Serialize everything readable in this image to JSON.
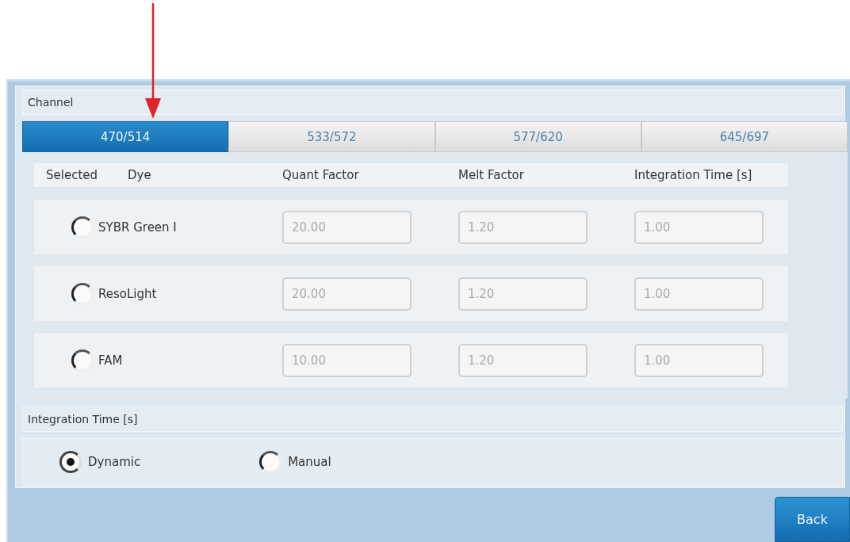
{
  "channel": {
    "title": "Channel",
    "tabs": [
      {
        "label": "470/514",
        "selected": true
      },
      {
        "label": "533/572",
        "selected": false
      },
      {
        "label": "577/620",
        "selected": false
      },
      {
        "label": "645/697",
        "selected": false
      }
    ]
  },
  "dyes": {
    "columns": [
      "Selected",
      "Dye",
      "Quant Factor",
      "Melt Factor",
      "Integration Time [s]"
    ],
    "rows": [
      {
        "name": "SYBR Green I",
        "selected": false,
        "quant_factor": "20.00",
        "melt_factor": "1.20",
        "integration_time": "1.00"
      },
      {
        "name": "ResoLight",
        "selected": false,
        "quant_factor": "20.00",
        "melt_factor": "1.20",
        "integration_time": "1.00"
      },
      {
        "name": "FAM",
        "selected": false,
        "quant_factor": "10.00",
        "melt_factor": "1.20",
        "integration_time": "1.00"
      }
    ]
  },
  "integration_time": {
    "title": "Integration Time [s]",
    "options": [
      {
        "label": "Dynamic",
        "selected": true
      },
      {
        "label": "Manual",
        "selected": false
      }
    ]
  },
  "buttons": [
    "Back"
  ]
}
